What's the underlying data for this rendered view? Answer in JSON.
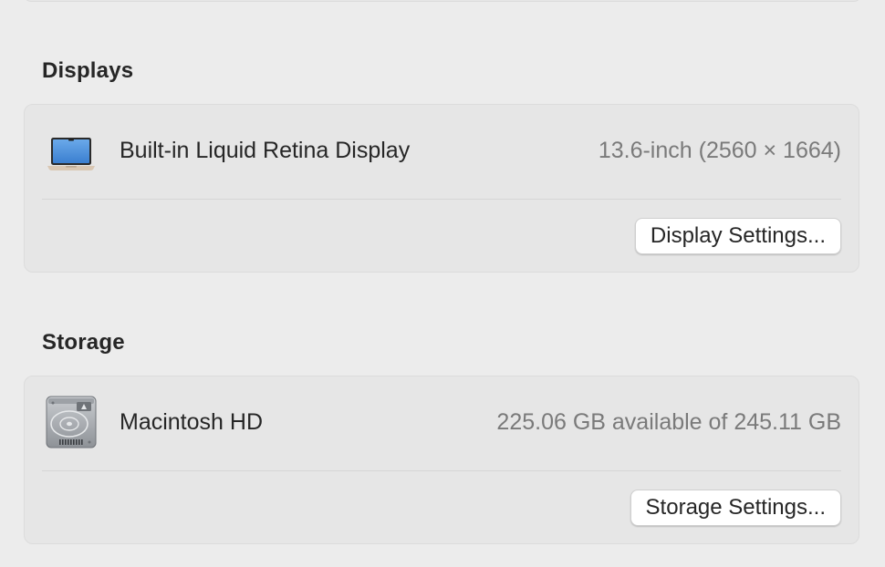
{
  "displays": {
    "section_title": "Displays",
    "item": {
      "label": "Built-in Liquid Retina Display",
      "value": "13.6-inch (2560 × 1664)",
      "icon": "laptop-icon"
    },
    "button_label": "Display Settings..."
  },
  "storage": {
    "section_title": "Storage",
    "item": {
      "label": "Macintosh HD",
      "value": "225.06 GB available of 245.11 GB",
      "icon": "hard-drive-icon"
    },
    "button_label": "Storage Settings..."
  },
  "colors": {
    "background": "#ececec",
    "panel": "#e6e6e6",
    "secondary_text": "#7a7a7a",
    "laptop_screen": "#4a90e2"
  }
}
